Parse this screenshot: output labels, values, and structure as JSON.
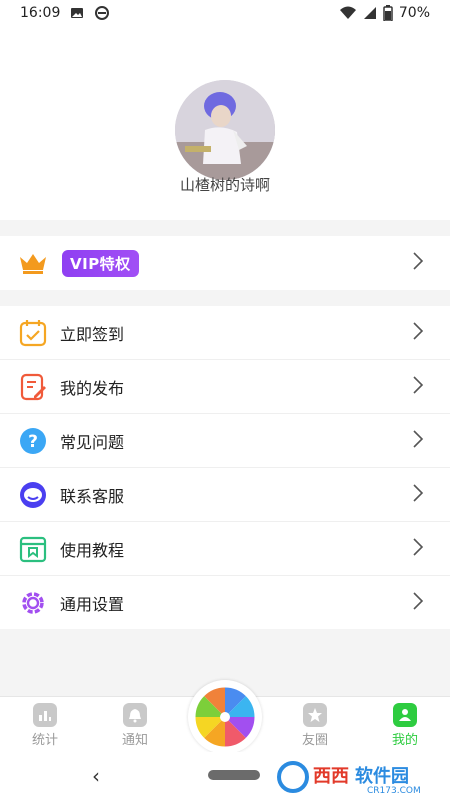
{
  "status_bar": {
    "time": "16:09",
    "battery": "70%"
  },
  "profile": {
    "username": "山楂树的诗啊"
  },
  "vip": {
    "label": "VIP特权"
  },
  "menu": [
    {
      "label": "立即签到",
      "icon": "calendar-check-icon",
      "color": "#f5a623"
    },
    {
      "label": "我的发布",
      "icon": "edit-document-icon",
      "color": "#f05a3a"
    },
    {
      "label": "常见问题",
      "icon": "question-icon",
      "color": "#3ba7f5"
    },
    {
      "label": "联系客服",
      "icon": "customer-service-icon",
      "color": "#4a3ff0"
    },
    {
      "label": "使用教程",
      "icon": "tutorial-box-icon",
      "color": "#2bbf7f"
    },
    {
      "label": "通用设置",
      "icon": "gear-icon",
      "color": "#a24ff0"
    }
  ],
  "bottom_nav": {
    "items": [
      {
        "label": "统计",
        "icon": "chart-icon",
        "active": false
      },
      {
        "label": "通知",
        "icon": "bell-icon",
        "active": false
      },
      {
        "label": "友圈",
        "icon": "star-icon",
        "active": false
      },
      {
        "label": "我的",
        "icon": "person-icon",
        "active": true
      }
    ]
  },
  "watermark": {
    "text": "西西软件园",
    "subtext": "CR173.COM"
  },
  "colors": {
    "accent": "#2ecc40",
    "vip_purple": "#9b47f5",
    "crown": "#f39a1e"
  }
}
